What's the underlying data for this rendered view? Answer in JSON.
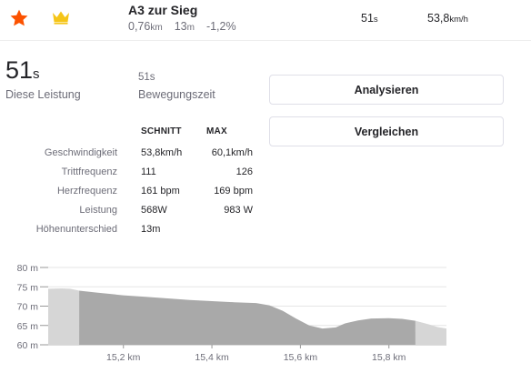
{
  "header": {
    "segment_name": "A3 zur Sieg",
    "distance_value": "0,76",
    "distance_unit": "km",
    "elevation_value": "13",
    "elevation_unit": "m",
    "grade": "-1,2%",
    "time_value": "51",
    "time_unit": "s",
    "speed_value": "53,8",
    "speed_unit": "km/h",
    "star_color": "#fc5200",
    "crown_color": "#f5c518"
  },
  "effort": {
    "elapsed_value": "51",
    "elapsed_unit": "s",
    "elapsed_label": "Diese Leistung",
    "moving_value": "51s",
    "moving_label": "Bewegungszeit"
  },
  "actions": {
    "analyze_label": "Analysieren",
    "compare_label": "Vergleichen"
  },
  "stats": {
    "col_avg": "SCHNITT",
    "col_max": "MAX",
    "rows": [
      {
        "label": "Geschwindigkeit",
        "avg": "53,8km/h",
        "max": "60,1km/h"
      },
      {
        "label": "Trittfrequenz",
        "avg": "111",
        "max": "126"
      },
      {
        "label": "Herzfrequenz",
        "avg": "161 bpm",
        "max": "169 bpm"
      },
      {
        "label": "Leistung",
        "avg": "568W",
        "max": "983 W"
      },
      {
        "label": "Höhenunterschied",
        "avg": "13m",
        "max": ""
      }
    ]
  },
  "chart_data": {
    "type": "area",
    "y_ticks": [
      "80 m",
      "75 m",
      "70 m",
      "65 m",
      "60 m"
    ],
    "x_ticks": [
      "15,2 km",
      "15,4 km",
      "15,6 km",
      "15,8 km"
    ],
    "y_range": [
      60,
      80
    ],
    "x_range": [
      15.03,
      15.93
    ],
    "segment_range": [
      15.1,
      15.86
    ],
    "grid": true,
    "colors": {
      "outside": "#d6d6d6",
      "segment": "#a9a9a9"
    },
    "x": [
      15.03,
      15.06,
      15.08,
      15.1,
      15.14,
      15.2,
      15.25,
      15.3,
      15.35,
      15.4,
      15.45,
      15.5,
      15.53,
      15.56,
      15.59,
      15.62,
      15.65,
      15.68,
      15.7,
      15.73,
      15.76,
      15.8,
      15.83,
      15.86,
      15.89,
      15.91,
      15.93
    ],
    "y": [
      74.5,
      74.6,
      74.5,
      74.0,
      73.5,
      72.8,
      72.4,
      72.0,
      71.6,
      71.3,
      71.0,
      70.8,
      70.2,
      68.8,
      66.8,
      65.0,
      64.2,
      64.5,
      65.5,
      66.3,
      66.8,
      66.9,
      66.7,
      66.2,
      65.3,
      64.6,
      64.2
    ]
  }
}
